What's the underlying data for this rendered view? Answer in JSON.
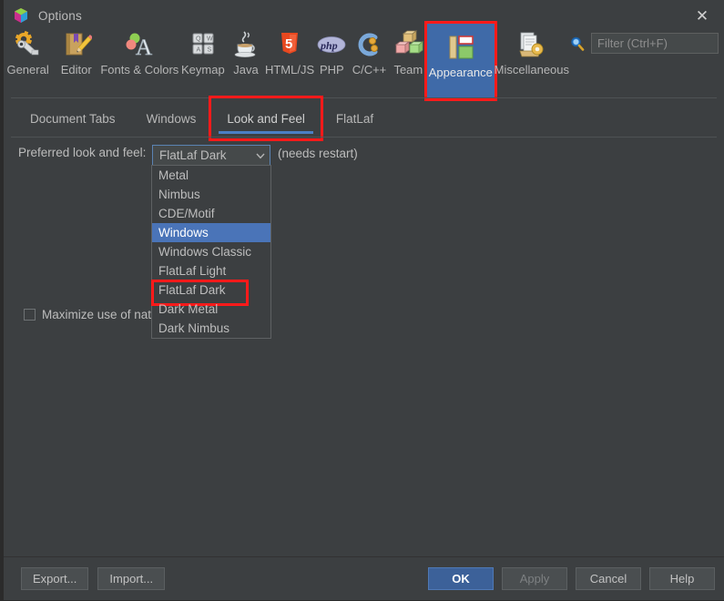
{
  "window": {
    "title": "Options",
    "app_icon": "jetbrains-cube-icon",
    "close_label": "✕"
  },
  "toolbar": {
    "categories": [
      {
        "label": "General",
        "icon": "gear-wrench-icon"
      },
      {
        "label": "Editor",
        "icon": "book-pencil-icon"
      },
      {
        "label": "Fonts & Colors",
        "icon": "palette-letter-a-icon"
      },
      {
        "label": "Keymap",
        "icon": "keyboard-keys-icon"
      },
      {
        "label": "Java",
        "icon": "coffee-cup-icon"
      },
      {
        "label": "HTML/JS",
        "icon": "html5-shield-icon"
      },
      {
        "label": "PHP",
        "icon": "php-elephant-icon"
      },
      {
        "label": "C/C++",
        "icon": "c-plus-plus-icon"
      },
      {
        "label": "Team",
        "icon": "team-blocks-icon"
      },
      {
        "label": "Appearance",
        "icon": "appearance-layout-icon",
        "selected": true,
        "highlighted": true
      },
      {
        "label": "Miscellaneous",
        "icon": "documents-gear-icon"
      }
    ],
    "search_icon": "search-icon",
    "filter_placeholder": "Filter (Ctrl+F)",
    "filter_value": ""
  },
  "tabs": [
    {
      "label": "Document Tabs",
      "active": false
    },
    {
      "label": "Windows",
      "active": false
    },
    {
      "label": "Look and Feel",
      "active": true,
      "highlighted": true
    },
    {
      "label": "FlatLaf",
      "active": false
    }
  ],
  "main": {
    "pref_label": "Preferred look and feel:",
    "combo_value": "FlatLaf Dark",
    "combo_arrow_icon": "chevron-down-icon",
    "needs_restart": "(needs restart)",
    "checkbox_label": "Maximize use of nati",
    "checkbox_checked": false,
    "dropdown_options": [
      {
        "label": "Metal"
      },
      {
        "label": "Nimbus"
      },
      {
        "label": "CDE/Motif"
      },
      {
        "label": "Windows",
        "selected": true
      },
      {
        "label": "Windows Classic"
      },
      {
        "label": "FlatLaf Light"
      },
      {
        "label": "FlatLaf Dark",
        "highlighted": true
      },
      {
        "label": "Dark Metal"
      },
      {
        "label": "Dark Nimbus"
      }
    ]
  },
  "footer": {
    "export_label": "Export...",
    "import_label": "Import...",
    "ok_label": "OK",
    "apply_label": "Apply",
    "apply_disabled": true,
    "cancel_label": "Cancel",
    "help_label": "Help"
  },
  "colors": {
    "background": "#3c3f41",
    "accent_blue": "#4a74b8",
    "tab_underline": "#4b7fc4",
    "highlight_red": "#ff1a1a",
    "primary_button": "#3c6199",
    "text": "#bcbcbc"
  }
}
